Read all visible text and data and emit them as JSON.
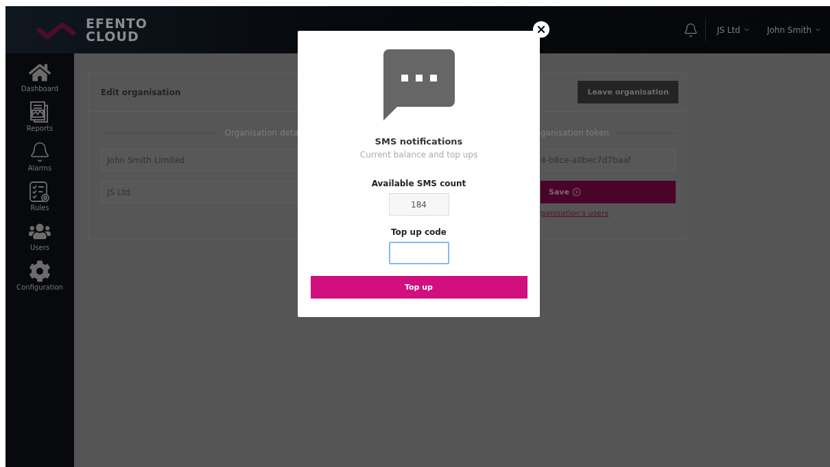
{
  "header": {
    "logo": {
      "line1": "EFENTO",
      "line2": "CLOUD"
    },
    "org_menu": "JS Ltd",
    "user_menu": "John Smith"
  },
  "sidebar": {
    "items": [
      {
        "label": "Dashboard"
      },
      {
        "label": "Reports"
      },
      {
        "label": "Alarms"
      },
      {
        "label": "Rules"
      },
      {
        "label": "Users"
      },
      {
        "label": "Configuration"
      }
    ]
  },
  "card": {
    "title": "Edit organisation",
    "leave_button": "Leave organisation",
    "details": {
      "heading": "Organisation deta",
      "fields": [
        "John Smith Limited",
        "JS Ltd"
      ]
    },
    "token": {
      "heading": "ganisation token",
      "value": "4-b8ce-a0bec7d7baaf",
      "save_button": "Save",
      "link": "ganisation's users"
    }
  },
  "modal": {
    "title": "SMS notifications",
    "subtitle": "Current balance and top ups",
    "count_label": "Available SMS count",
    "count_value": "184",
    "code_label": "Top up code",
    "button": "Top up"
  }
}
